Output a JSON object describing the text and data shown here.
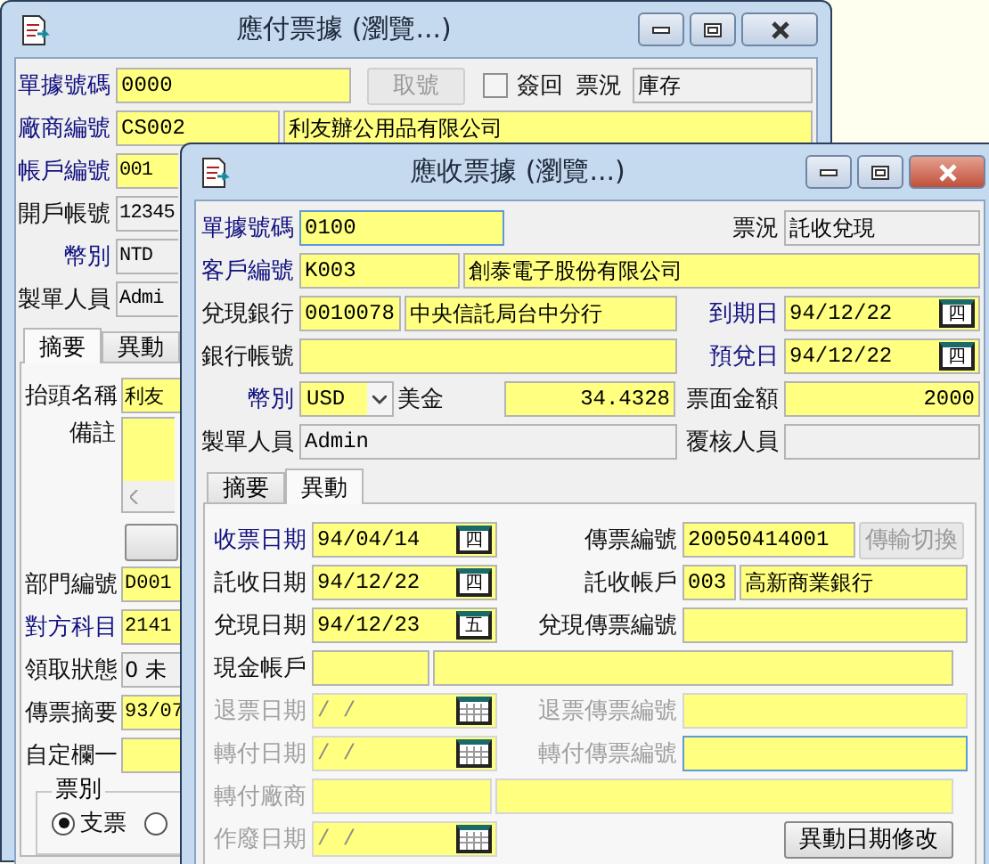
{
  "payable_window": {
    "title": "應付票據 (瀏覽...)",
    "active": false,
    "doc_no": {
      "label": "單據號碼",
      "value": "0000",
      "required": true
    },
    "fetch_button": {
      "label": "取號",
      "disabled": true
    },
    "signed_back": {
      "label": "簽回",
      "checked": false
    },
    "status": {
      "label": "票況",
      "value": "庫存"
    },
    "vendor": {
      "label": "廠商編號",
      "code": "CS002",
      "name": "利友辦公用品有限公司",
      "required": true
    },
    "rows": [
      {
        "label": "帳戶編號",
        "value": "001",
        "required": true,
        "readonly": false
      },
      {
        "label": "開戶帳號",
        "value": "12345",
        "required": false,
        "readonly": true
      },
      {
        "label": "幣別",
        "value": "NTD",
        "required": true,
        "readonly": true
      },
      {
        "label": "製單人員",
        "value": "Admi",
        "required": false,
        "readonly": true
      }
    ],
    "tabs": [
      {
        "label": "摘要",
        "selected": true
      },
      {
        "label": "異動",
        "selected": false
      }
    ],
    "summary": [
      {
        "kind": "field",
        "label": "抬頭名稱",
        "value": "利友",
        "required": false,
        "readonly": false
      },
      {
        "kind": "memo",
        "label": "備註"
      },
      {
        "kind": "button"
      },
      {
        "kind": "field",
        "label": "部門編號",
        "value": "D001",
        "required": false,
        "readonly": false
      },
      {
        "kind": "field",
        "label": "對方科目",
        "value": "2141",
        "required": true,
        "readonly": false
      },
      {
        "kind": "field",
        "label": "領取狀態",
        "value": "0 未",
        "required": false,
        "readonly": true
      },
      {
        "kind": "field",
        "label": "傳票摘要",
        "value": "93/07",
        "required": false,
        "readonly": false
      },
      {
        "kind": "field",
        "label": "自定欄一",
        "required": false,
        "readonly": false
      }
    ],
    "ticket_type": {
      "label": "票別",
      "options": [
        {
          "label": "支票",
          "selected": true
        },
        {
          "selected": false
        }
      ]
    }
  },
  "receivable_window": {
    "title": "應收票據 (瀏覽...)",
    "active": true,
    "doc_no": {
      "label": "單據號碼",
      "value": "0100",
      "required": true
    },
    "status": {
      "label": "票況",
      "value": "託收兌現"
    },
    "customer": {
      "label": "客戶編號",
      "code": "K003",
      "name": "創泰電子股份有限公司",
      "required": true
    },
    "bank": {
      "label": "兌現銀行",
      "code": "0010078",
      "name": "中央信託局台中分行",
      "required": false
    },
    "due_date": {
      "label": "到期日",
      "value": "94/12/22",
      "calendar_day": "四",
      "required": true
    },
    "bank_account": {
      "label": "銀行帳號",
      "required": false
    },
    "expected_date": {
      "label": "預兌日",
      "value": "94/12/22",
      "calendar_day": "四",
      "required": true
    },
    "currency": {
      "label": "幣別",
      "code": "USD",
      "name": "美金",
      "rate": "34.4328",
      "required": true
    },
    "face_amount": {
      "label": "票面金額",
      "value": "2000",
      "required": false
    },
    "creator": {
      "label": "製單人員",
      "value": "Admin",
      "required": false
    },
    "reviewer": {
      "label": "覆核人員",
      "required": false
    },
    "tabs": [
      {
        "label": "摘要",
        "selected": false
      },
      {
        "label": "異動",
        "selected": true
      }
    ],
    "change_rows": [
      {
        "left": {
          "kind": "date",
          "label": "收票日期",
          "value": "94/04/14",
          "calendar_day": "四",
          "required": true,
          "disabled": false
        },
        "right": {
          "kind": "text_button",
          "label": "傳票編號",
          "value": "20050414001",
          "button": {
            "label": "傳輸切換",
            "disabled": true
          }
        }
      },
      {
        "left": {
          "kind": "date",
          "label": "託收日期",
          "value": "94/12/22",
          "calendar_day": "四",
          "required": false,
          "disabled": false
        },
        "right": {
          "kind": "pair",
          "label": "託收帳戶",
          "code": "003",
          "name": "高新商業銀行",
          "disabled": false
        }
      },
      {
        "left": {
          "kind": "date",
          "label": "兌現日期",
          "value": "94/12/23",
          "calendar_day": "五",
          "required": false,
          "disabled": false
        },
        "right": {
          "kind": "text",
          "label": "兌現傳票編號",
          "disabled": false,
          "focused": false
        }
      },
      {
        "left": {
          "kind": "pair",
          "label": "現金帳戶",
          "required": false,
          "disabled": false,
          "wide": false
        }
      },
      {
        "left": {
          "kind": "date",
          "label": "退票日期",
          "value": "/ /",
          "required": false,
          "disabled": true
        },
        "right": {
          "kind": "text",
          "label": "退票傳票編號",
          "disabled": true,
          "focused": false
        }
      },
      {
        "left": {
          "kind": "date",
          "label": "轉付日期",
          "value": "/ /",
          "required": false,
          "disabled": true
        },
        "right": {
          "kind": "text",
          "label": "轉付傳票編號",
          "disabled": true,
          "focused": true
        }
      },
      {
        "left": {
          "kind": "pair",
          "label": "轉付廠商",
          "required": false,
          "disabled": true,
          "wide": true
        }
      },
      {
        "left": {
          "kind": "date",
          "label": "作廢日期",
          "value": "/ /",
          "required": false,
          "disabled": true
        },
        "right": {
          "kind": "button",
          "label": "異動日期修改"
        }
      }
    ]
  }
}
